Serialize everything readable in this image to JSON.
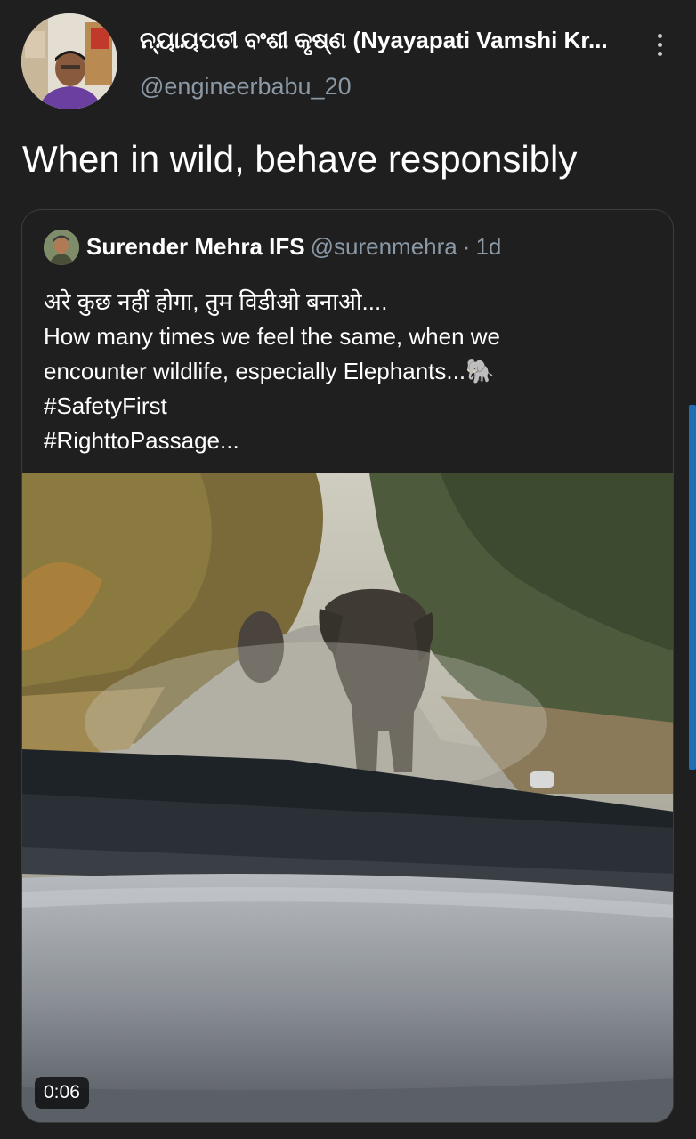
{
  "tweet": {
    "author_name": "ନ୍ୟାୟପତୀ ବଂଶୀ କୃଷ୍ଣ (Nyayapati Vamshi Kr...",
    "author_handle": "@engineerbabu_20",
    "text": "When in wild, behave responsibly",
    "more_icon": "more-vertical-icon"
  },
  "quoted": {
    "name": "Surender Mehra IFS",
    "handle": "@surenmehra",
    "separator": "·",
    "time": "1d",
    "lines": [
      "अरे कुछ नहीं होगा, तुम विडीओ बनाओ....",
      "How many times we feel the same, when we",
      "encounter wildlife, especially Elephants...🐘",
      "#SafetyFirst",
      "#RighttoPassage..."
    ],
    "video_duration": "0:06"
  },
  "colors": {
    "background": "#1f1f1f",
    "secondary_text": "#8b98a5",
    "scroll_indicator": "#1d6fb8"
  }
}
